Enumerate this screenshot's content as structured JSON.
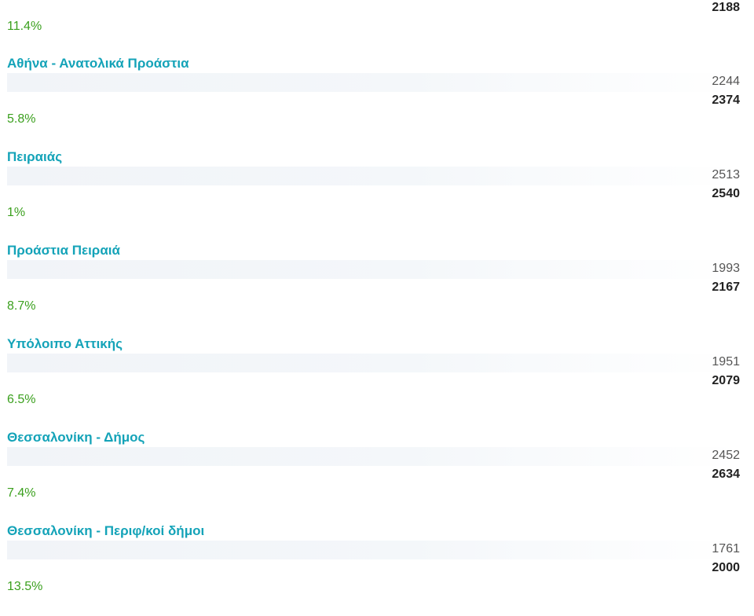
{
  "header_partial": {
    "current": "2188",
    "change": "11.4%"
  },
  "rows": [
    {
      "region": "Αθήνα - Ανατολικά Προάστια",
      "previous": "2244",
      "current": "2374",
      "change": "5.8%"
    },
    {
      "region": "Πειραιάς",
      "previous": "2513",
      "current": "2540",
      "change": "1%"
    },
    {
      "region": "Προάστια Πειραιά",
      "previous": "1993",
      "current": "2167",
      "change": "8.7%"
    },
    {
      "region": "Υπόλοιπο Αττικής",
      "previous": "1951",
      "current": "2079",
      "change": "6.5%"
    },
    {
      "region": "Θεσσαλονίκη - Δήμος",
      "previous": "2452",
      "current": "2634",
      "change": "7.4%"
    },
    {
      "region": "Θεσσαλονίκη - Περιφ/κοί δήμοι",
      "previous": "1761",
      "current": "2000",
      "change": "13.5%"
    }
  ],
  "colors": {
    "region": "#14a3b8",
    "change": "#3ba01e",
    "previous": "#555555",
    "current": "#222222",
    "bar": "#f1f4f8"
  }
}
